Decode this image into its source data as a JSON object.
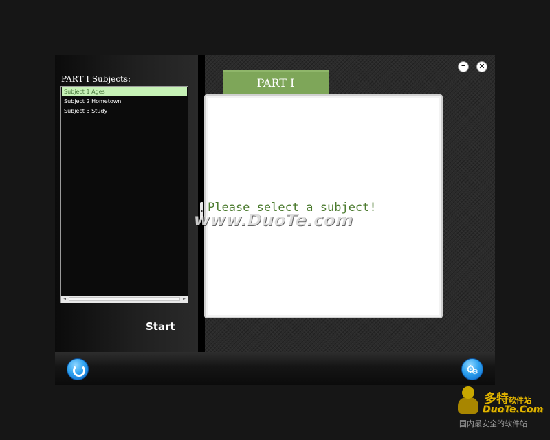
{
  "left_panel": {
    "title": "PART Ⅰ Subjects:",
    "subjects": [
      {
        "label": "Subject 1 Ages",
        "selected": true
      },
      {
        "label": "Subject 2 Hometown",
        "selected": false
      },
      {
        "label": "Subject 3 Study",
        "selected": false
      }
    ],
    "scrollbar": {
      "left_arrow": "◄",
      "right_arrow": "►"
    },
    "start_label": "Start"
  },
  "content": {
    "tab_label": "PART Ⅰ",
    "prompt": "Please select a subject!"
  },
  "window_controls": {
    "minimize_label": "–",
    "close_label": "✕"
  },
  "bottom_bar": {
    "refresh_icon": "refresh-icon",
    "settings_icon": "gears-icon"
  },
  "watermark": {
    "url_text": "www.DuoTe.com",
    "logo_cn": "多特",
    "logo_cn_small": "软件站",
    "logo_en": "DuoTe.Com",
    "logo_tagline": "国内最安全的软件站"
  },
  "colors": {
    "selected_item_bg": "#c6f1b6",
    "tab_green": "#7ea659",
    "prompt_green": "#4c7b2f",
    "button_blue": "#2fa3f0",
    "logo_gold": "#e1b400"
  }
}
